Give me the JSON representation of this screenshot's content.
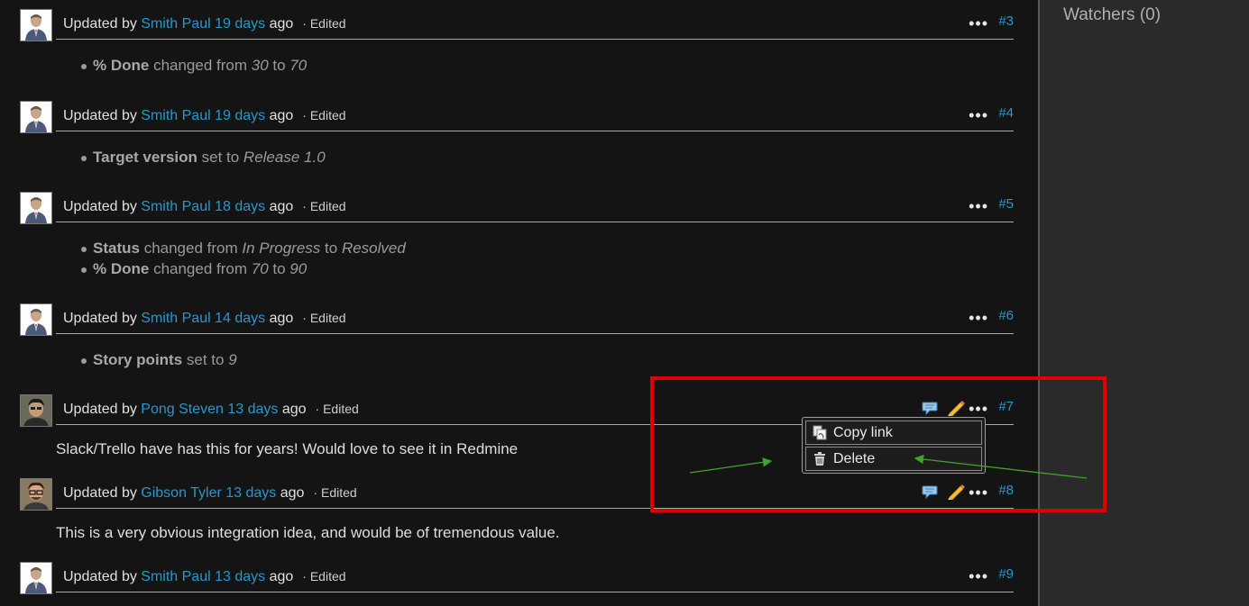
{
  "sidebar": {
    "watchers_label": "Watchers (0)"
  },
  "journals": [
    {
      "prefix": "Updated by ",
      "author": "Smith Paul",
      "time": "19 days",
      "suffix": " ago",
      "edited": "· Edited",
      "number": "#3",
      "details": [
        {
          "field": "% Done",
          "mid": " changed from ",
          "from": "30",
          "sep": " to ",
          "to": "70"
        }
      ]
    },
    {
      "prefix": "Updated by ",
      "author": "Smith Paul",
      "time": "19 days",
      "suffix": " ago",
      "edited": "· Edited",
      "number": "#4",
      "details": [
        {
          "field": "Target version",
          "mid": " set to ",
          "to": "Release 1.0"
        }
      ]
    },
    {
      "prefix": "Updated by ",
      "author": "Smith Paul",
      "time": "18 days",
      "suffix": " ago",
      "edited": "· Edited",
      "number": "#5",
      "details": [
        {
          "field": "Status",
          "mid": " changed from ",
          "from": "In Progress",
          "sep": " to ",
          "to": "Resolved"
        },
        {
          "field": "% Done",
          "mid": " changed from ",
          "from": "70",
          "sep": " to ",
          "to": "90"
        }
      ]
    },
    {
      "prefix": "Updated by ",
      "author": "Smith Paul",
      "time": "14 days",
      "suffix": " ago",
      "edited": "· Edited",
      "number": "#6",
      "details": [
        {
          "field": "Story points",
          "mid": " set to ",
          "to": "9"
        }
      ]
    },
    {
      "prefix": "Updated by ",
      "author": "Pong Steven",
      "time": "13 days",
      "suffix": " ago",
      "edited": "· Edited",
      "number": "#7",
      "notes": "Slack/Trello have has this for years! Would love to see it in Redmine"
    },
    {
      "prefix": "Updated by ",
      "author": "Gibson Tyler",
      "time": "13 days",
      "suffix": " ago",
      "edited": "· Edited",
      "number": "#8",
      "notes": "This is a very obvious integration idea, and would be of tremendous value."
    },
    {
      "prefix": "Updated by ",
      "author": "Smith Paul",
      "time": "13 days",
      "suffix": " ago",
      "edited": "· Edited",
      "number": "#9"
    }
  ],
  "context_menu": {
    "copy_link": "Copy link",
    "delete": "Delete"
  },
  "more_icon_glyph": "•••",
  "colors": {
    "link": "#2996cc",
    "highlight": "#e00000",
    "arrow": "#3fa32a",
    "background": "#141414",
    "sidebar": "#2a2a2a"
  }
}
